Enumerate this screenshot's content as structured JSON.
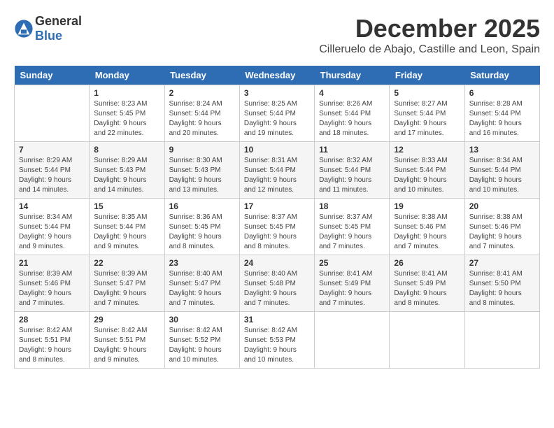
{
  "header": {
    "logo_general": "General",
    "logo_blue": "Blue",
    "month": "December 2025",
    "location": "Cilleruelo de Abajo, Castille and Leon, Spain"
  },
  "columns": [
    "Sunday",
    "Monday",
    "Tuesday",
    "Wednesday",
    "Thursday",
    "Friday",
    "Saturday"
  ],
  "weeks": [
    [
      {
        "day": "",
        "text": ""
      },
      {
        "day": "1",
        "text": "Sunrise: 8:23 AM\nSunset: 5:45 PM\nDaylight: 9 hours\nand 22 minutes."
      },
      {
        "day": "2",
        "text": "Sunrise: 8:24 AM\nSunset: 5:44 PM\nDaylight: 9 hours\nand 20 minutes."
      },
      {
        "day": "3",
        "text": "Sunrise: 8:25 AM\nSunset: 5:44 PM\nDaylight: 9 hours\nand 19 minutes."
      },
      {
        "day": "4",
        "text": "Sunrise: 8:26 AM\nSunset: 5:44 PM\nDaylight: 9 hours\nand 18 minutes."
      },
      {
        "day": "5",
        "text": "Sunrise: 8:27 AM\nSunset: 5:44 PM\nDaylight: 9 hours\nand 17 minutes."
      },
      {
        "day": "6",
        "text": "Sunrise: 8:28 AM\nSunset: 5:44 PM\nDaylight: 9 hours\nand 16 minutes."
      }
    ],
    [
      {
        "day": "7",
        "text": "Sunrise: 8:29 AM\nSunset: 5:44 PM\nDaylight: 9 hours\nand 14 minutes."
      },
      {
        "day": "8",
        "text": "Sunrise: 8:29 AM\nSunset: 5:43 PM\nDaylight: 9 hours\nand 14 minutes."
      },
      {
        "day": "9",
        "text": "Sunrise: 8:30 AM\nSunset: 5:43 PM\nDaylight: 9 hours\nand 13 minutes."
      },
      {
        "day": "10",
        "text": "Sunrise: 8:31 AM\nSunset: 5:44 PM\nDaylight: 9 hours\nand 12 minutes."
      },
      {
        "day": "11",
        "text": "Sunrise: 8:32 AM\nSunset: 5:44 PM\nDaylight: 9 hours\nand 11 minutes."
      },
      {
        "day": "12",
        "text": "Sunrise: 8:33 AM\nSunset: 5:44 PM\nDaylight: 9 hours\nand 10 minutes."
      },
      {
        "day": "13",
        "text": "Sunrise: 8:34 AM\nSunset: 5:44 PM\nDaylight: 9 hours\nand 10 minutes."
      }
    ],
    [
      {
        "day": "14",
        "text": "Sunrise: 8:34 AM\nSunset: 5:44 PM\nDaylight: 9 hours\nand 9 minutes."
      },
      {
        "day": "15",
        "text": "Sunrise: 8:35 AM\nSunset: 5:44 PM\nDaylight: 9 hours\nand 9 minutes."
      },
      {
        "day": "16",
        "text": "Sunrise: 8:36 AM\nSunset: 5:45 PM\nDaylight: 9 hours\nand 8 minutes."
      },
      {
        "day": "17",
        "text": "Sunrise: 8:37 AM\nSunset: 5:45 PM\nDaylight: 9 hours\nand 8 minutes."
      },
      {
        "day": "18",
        "text": "Sunrise: 8:37 AM\nSunset: 5:45 PM\nDaylight: 9 hours\nand 7 minutes."
      },
      {
        "day": "19",
        "text": "Sunrise: 8:38 AM\nSunset: 5:46 PM\nDaylight: 9 hours\nand 7 minutes."
      },
      {
        "day": "20",
        "text": "Sunrise: 8:38 AM\nSunset: 5:46 PM\nDaylight: 9 hours\nand 7 minutes."
      }
    ],
    [
      {
        "day": "21",
        "text": "Sunrise: 8:39 AM\nSunset: 5:46 PM\nDaylight: 9 hours\nand 7 minutes."
      },
      {
        "day": "22",
        "text": "Sunrise: 8:39 AM\nSunset: 5:47 PM\nDaylight: 9 hours\nand 7 minutes."
      },
      {
        "day": "23",
        "text": "Sunrise: 8:40 AM\nSunset: 5:47 PM\nDaylight: 9 hours\nand 7 minutes."
      },
      {
        "day": "24",
        "text": "Sunrise: 8:40 AM\nSunset: 5:48 PM\nDaylight: 9 hours\nand 7 minutes."
      },
      {
        "day": "25",
        "text": "Sunrise: 8:41 AM\nSunset: 5:49 PM\nDaylight: 9 hours\nand 7 minutes."
      },
      {
        "day": "26",
        "text": "Sunrise: 8:41 AM\nSunset: 5:49 PM\nDaylight: 9 hours\nand 8 minutes."
      },
      {
        "day": "27",
        "text": "Sunrise: 8:41 AM\nSunset: 5:50 PM\nDaylight: 9 hours\nand 8 minutes."
      }
    ],
    [
      {
        "day": "28",
        "text": "Sunrise: 8:42 AM\nSunset: 5:51 PM\nDaylight: 9 hours\nand 8 minutes."
      },
      {
        "day": "29",
        "text": "Sunrise: 8:42 AM\nSunset: 5:51 PM\nDaylight: 9 hours\nand 9 minutes."
      },
      {
        "day": "30",
        "text": "Sunrise: 8:42 AM\nSunset: 5:52 PM\nDaylight: 9 hours\nand 10 minutes."
      },
      {
        "day": "31",
        "text": "Sunrise: 8:42 AM\nSunset: 5:53 PM\nDaylight: 9 hours\nand 10 minutes."
      },
      {
        "day": "",
        "text": ""
      },
      {
        "day": "",
        "text": ""
      },
      {
        "day": "",
        "text": ""
      }
    ]
  ]
}
